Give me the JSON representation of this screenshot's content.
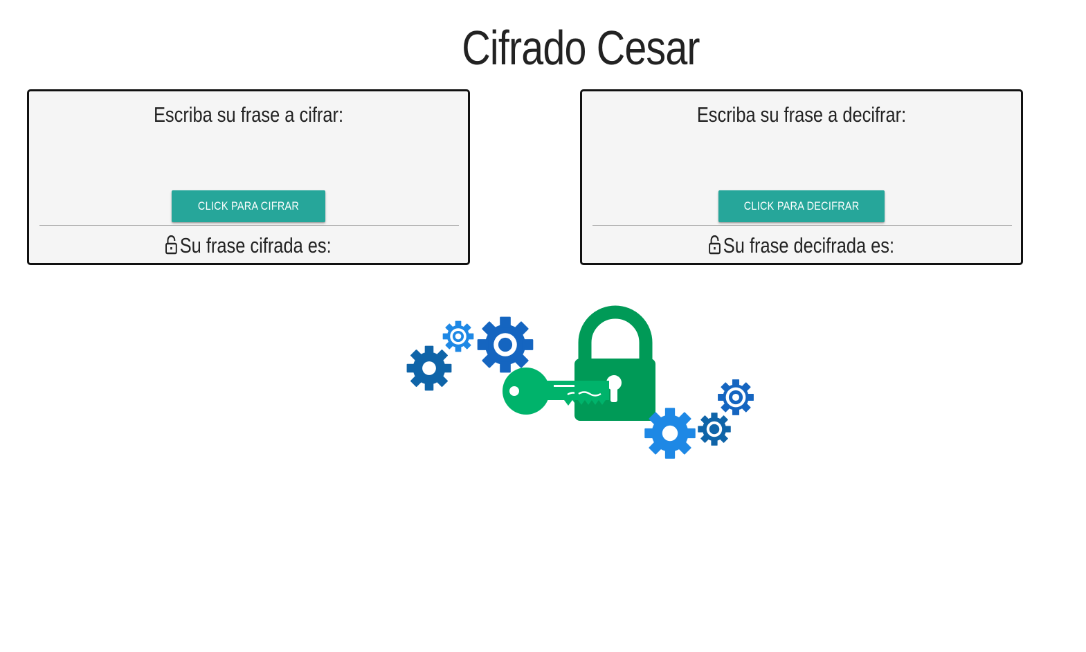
{
  "title": "Cifrado Cesar",
  "encrypt": {
    "label": "Escriba su frase a cifrar:",
    "input_value": "",
    "button_label": "Click para cifrar",
    "result_label": "Su frase cifrada es:"
  },
  "decrypt": {
    "label": "Escriba su frase a decifrar:",
    "input_value": "",
    "button_label": "Click para decifrar",
    "result_label": "Su frase decifrada es:"
  },
  "icons": {
    "result_icon": "lock-open-icon",
    "illustration": "encryption-gears-key-padlock-illustration"
  },
  "colors": {
    "button": "#26a69a",
    "card_background": "#f5f5f5",
    "card_border": "#111111",
    "gear_dark_blue": "#0f64a8",
    "gear_light_blue": "#1e88e5",
    "padlock_green": "#009a57",
    "key_green": "#00b36b"
  }
}
